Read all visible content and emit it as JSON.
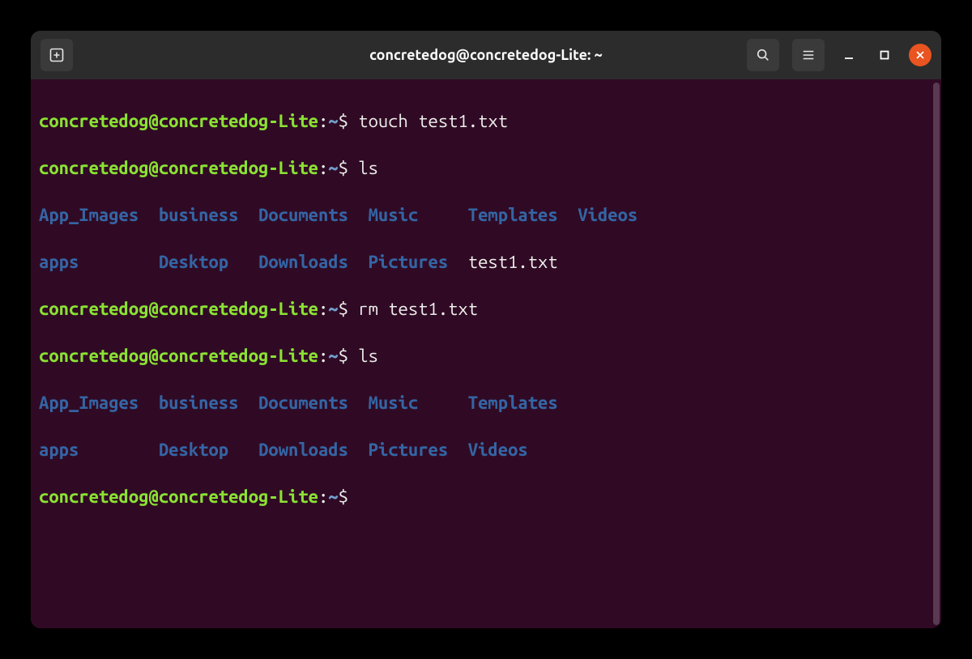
{
  "titlebar": {
    "title": "concretedog@concretedog-Lite: ~"
  },
  "prompt": {
    "user_host": "concretedog@concretedog-Lite",
    "colon": ":",
    "path": "~",
    "dollar": "$"
  },
  "session": {
    "cmd1": "touch test1.txt",
    "cmd2": "ls",
    "ls1": {
      "row1": {
        "c1": "App_Images",
        "c2": "business",
        "c3": "Documents",
        "c4": "Music",
        "c5": "Templates",
        "c6": "Videos"
      },
      "row2": {
        "c1": "apps",
        "c2": "Desktop",
        "c3": "Downloads",
        "c4": "Pictures",
        "c5": "test1.txt"
      }
    },
    "cmd3": "rm test1.txt",
    "cmd4": "ls",
    "ls2": {
      "row1": {
        "c1": "App_Images",
        "c2": "business",
        "c3": "Documents",
        "c4": "Music",
        "c5": "Templates"
      },
      "row2": {
        "c1": "apps",
        "c2": "Desktop",
        "c3": "Downloads",
        "c4": "Pictures",
        "c5": "Videos"
      }
    }
  },
  "colors": {
    "bg": "#300a24",
    "user": "#8ae234",
    "path": "#729fcf",
    "dir": "#3465a4",
    "text": "#eeeeec",
    "titlebar": "#2c2c2c",
    "close": "#e95420"
  }
}
